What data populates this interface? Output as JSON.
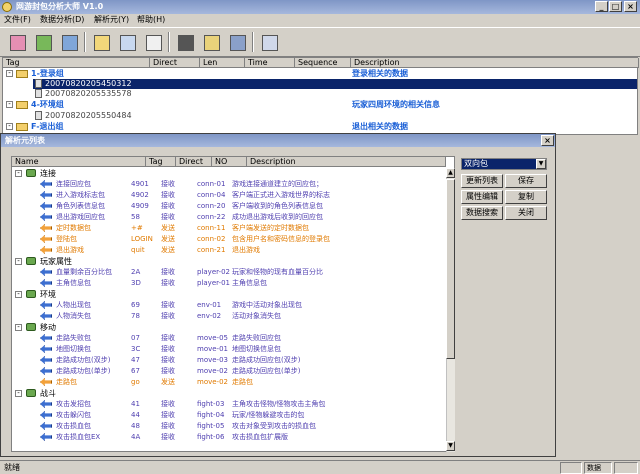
{
  "app": {
    "title": "网游封包分析大师 V1.0"
  },
  "menu": [
    "文件(F)",
    "数据分析(D)",
    "解析元(Y)",
    "帮助(H)"
  ],
  "main": {
    "columns": [
      "Tag",
      "Direct",
      "Len",
      "Time",
      "Sequence",
      "Description"
    ],
    "groups": [
      {
        "label": "1-登录组",
        "desc": "登录相关的数据",
        "children": [
          "20070820205450312",
          "20070820205535578"
        ]
      },
      {
        "label": "4-环境组",
        "desc": "玩家四周环境的相关信息",
        "children": [
          "20070820205550484"
        ]
      },
      {
        "label": "F-退出组",
        "desc": "退出相关的数据",
        "children": []
      }
    ]
  },
  "dialog": {
    "title": "解析元列表",
    "columns": [
      "Name",
      "Tag",
      "Direct",
      "NO",
      "Description"
    ],
    "categories": [
      {
        "name": "连接",
        "items": [
          {
            "name": "连接回应包",
            "tag": "4901",
            "dir": "接收",
            "no": "conn-01",
            "desc": "游戏连接通道建立的回应包；",
            "c": "purple"
          },
          {
            "name": "进入游戏标志包",
            "tag": "4902",
            "dir": "接收",
            "no": "conn-04",
            "desc": "客户端正式进入游戏世界的标志",
            "c": "purple"
          },
          {
            "name": "角色列表信息包",
            "tag": "4909",
            "dir": "接收",
            "no": "conn-20",
            "desc": "客户端收到的角色列表信息包",
            "c": "purple"
          },
          {
            "name": "退出游戏回应包",
            "tag": "58",
            "dir": "接收",
            "no": "conn-22",
            "desc": "成功退出游戏后收到的回应包",
            "c": "purple"
          },
          {
            "name": "定时数据包",
            "tag": "+#",
            "dir": "发送",
            "no": "conn-11",
            "desc": "客户端发送的定时数据包",
            "c": "orange"
          },
          {
            "name": "登陆包",
            "tag": "LOGIN",
            "dir": "发送",
            "no": "conn-02",
            "desc": "包含用户名和密码信息的登录包",
            "c": "orange"
          },
          {
            "name": "退出游戏",
            "tag": "quit",
            "dir": "发送",
            "no": "conn-21",
            "desc": "退出游戏",
            "c": "orange"
          }
        ]
      },
      {
        "name": "玩家属性",
        "items": [
          {
            "name": "血量剩余百分比包",
            "tag": "2A",
            "dir": "接收",
            "no": "player-02",
            "desc": "玩家和怪物的现有血量百分比",
            "c": "purple"
          },
          {
            "name": "主角信息包",
            "tag": "3D",
            "dir": "接收",
            "no": "player-01",
            "desc": "主角信息包",
            "c": "purple"
          }
        ]
      },
      {
        "name": "环境",
        "items": [
          {
            "name": "人物出现包",
            "tag": "69",
            "dir": "接收",
            "no": "env-01",
            "desc": "游戏中活动对象出现包",
            "c": "purple"
          },
          {
            "name": "人物消失包",
            "tag": "78",
            "dir": "接收",
            "no": "env-02",
            "desc": "活动对象消失包",
            "c": "purple"
          }
        ]
      },
      {
        "name": "移动",
        "items": [
          {
            "name": "走路失败包",
            "tag": "07",
            "dir": "接收",
            "no": "move-05",
            "desc": "走路失败回应包",
            "c": "purple"
          },
          {
            "name": "地图切换包",
            "tag": "3C",
            "dir": "接收",
            "no": "move-01",
            "desc": "地图切换信息包",
            "c": "purple"
          },
          {
            "name": "走路成功包(双步)",
            "tag": "47",
            "dir": "接收",
            "no": "move-03",
            "desc": "走路成功回应包(双步)",
            "c": "purple"
          },
          {
            "name": "走路成功包(单步)",
            "tag": "67",
            "dir": "接收",
            "no": "move-02",
            "desc": "走路成功回应包(单步)",
            "c": "purple"
          },
          {
            "name": "走路包",
            "tag": "go",
            "dir": "发送",
            "no": "move-02",
            "desc": "走路包",
            "c": "orange"
          }
        ]
      },
      {
        "name": "战斗",
        "items": [
          {
            "name": "攻击发招包",
            "tag": "41",
            "dir": "接收",
            "no": "fight-03",
            "desc": "主角攻击怪物/怪物攻击主角包",
            "c": "purple"
          },
          {
            "name": "攻击躲闪包",
            "tag": "44",
            "dir": "接收",
            "no": "fight-04",
            "desc": "玩家/怪物躲避攻击的包",
            "c": "purple"
          },
          {
            "name": "攻击损血包",
            "tag": "48",
            "dir": "接收",
            "no": "fight-05",
            "desc": "攻击对象受到攻击的损血包",
            "c": "purple"
          },
          {
            "name": "攻击损血包EX",
            "tag": "4A",
            "dir": "接收",
            "no": "fight-06",
            "desc": "攻击损血包扩展版",
            "c": "purple"
          }
        ]
      }
    ],
    "combo": "双向包",
    "buttons": [
      "更新列表",
      "保存",
      "属性编辑",
      "复制",
      "数据搜索",
      "关闭"
    ]
  },
  "status": {
    "left": "就绪",
    "right": "数据"
  }
}
